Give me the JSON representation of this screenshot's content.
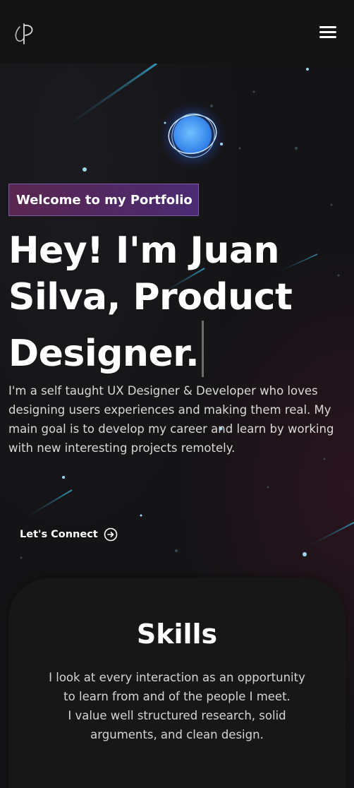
{
  "header": {
    "logo_icon": "jp-monogram-logo",
    "menu_icon": "hamburger-menu-icon"
  },
  "hero": {
    "badge": "Welcome to my Portfolio",
    "headline_lines": [
      "Hey! I'm Juan",
      "Silva, Product",
      "Designer."
    ],
    "intro": "I'm a self taught UX Designer & Developer who loves designing users experiences and making them real. My main goal is to develop my career and learn by working with new interesting projects remotely.",
    "cta_label": "Let's Connect",
    "cta_icon": "arrow-circle-right-icon"
  },
  "skills": {
    "title": "Skills",
    "description_lines": [
      "I look at every interaction as an opportunity to learn from and of the people I meet.",
      "I value well structured research, solid arguments, and clean design."
    ]
  },
  "colors": {
    "background": "#131313",
    "badge_gradient_start": "#5a2750",
    "badge_gradient_end": "#4a2a72",
    "badge_border": "#7b5aa8",
    "accent_glow": "#4fa3ff",
    "streak": "#2b7a9a"
  }
}
